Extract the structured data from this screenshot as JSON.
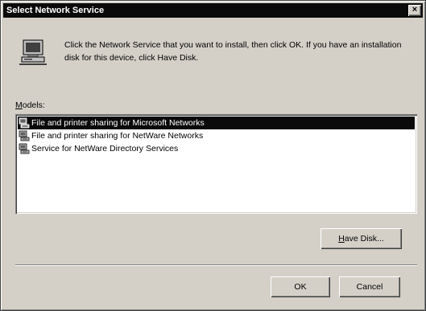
{
  "window": {
    "title": "Select Network Service",
    "close_label": "×"
  },
  "header": {
    "icon": "network-computer-icon",
    "instruction": "Click the Network Service that you want to install, then click OK. If you have an installation disk for this device, click Have Disk."
  },
  "models": {
    "label_mnemonic": "M",
    "label_rest": "odels:",
    "items": [
      {
        "label": "File and printer sharing for Microsoft Networks",
        "icon": "network-service-icon",
        "selected": true
      },
      {
        "label": "File and printer sharing for NetWare Networks",
        "icon": "network-service-icon",
        "selected": false
      },
      {
        "label": "Service for NetWare Directory Services",
        "icon": "network-service-icon",
        "selected": false
      }
    ]
  },
  "buttons": {
    "have_disk_mnemonic": "H",
    "have_disk_rest": "ave Disk...",
    "ok": "OK",
    "cancel": "Cancel"
  },
  "colors": {
    "selection": "#0a0a0a",
    "titlebar": "#0a0a0a",
    "face": "#d4d0c8"
  }
}
